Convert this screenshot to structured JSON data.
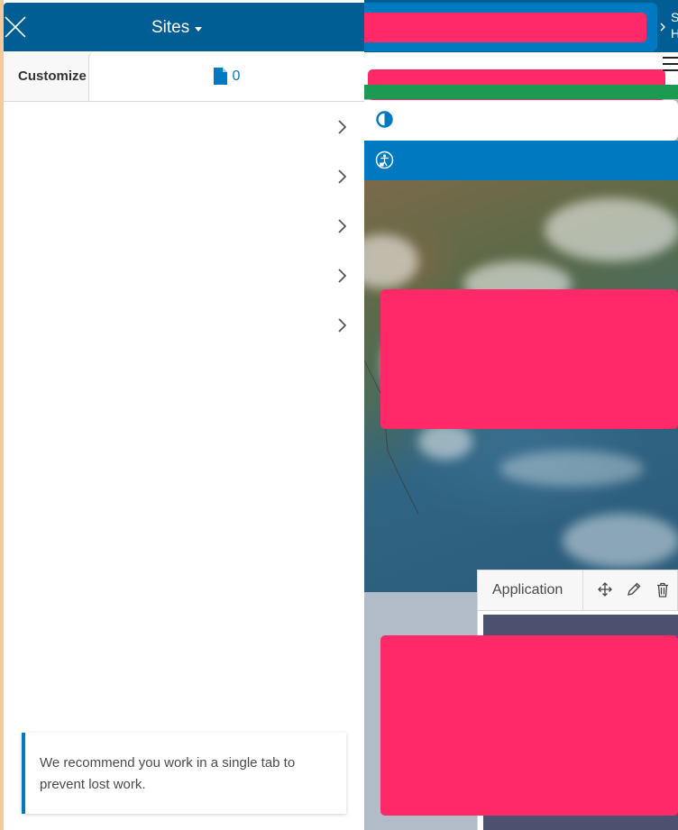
{
  "header": {
    "title": "Sites",
    "close_icon": "close-icon",
    "caret_icon": "caret-down-icon"
  },
  "tabs": {
    "customize_label": "Customize",
    "pages_count": "0",
    "pages_icon": "document-icon"
  },
  "menu": {
    "items": [
      {
        "chevron": "chevron-right-icon"
      },
      {
        "chevron": "chevron-right-icon"
      },
      {
        "chevron": "chevron-right-icon"
      },
      {
        "chevron": "chevron-right-icon"
      },
      {
        "chevron": "chevron-right-icon"
      }
    ]
  },
  "toast": {
    "message": "We recommend you work in a single tab to prevent lost work."
  },
  "preview": {
    "breadcrumb": [
      "S",
      "H"
    ],
    "hamburger_icon": "hamburger-menu-icon",
    "contrast_icon": "contrast-icon",
    "accessibility_icon": "accessibility-lock-icon",
    "app_toolbar": {
      "label": "Application",
      "move_icon": "move-icon",
      "edit_icon": "pencil-icon",
      "delete_icon": "trash-icon"
    }
  },
  "colors": {
    "header_blue": "#005e95",
    "accent_blue": "#0079c1",
    "redaction": "#ff2968",
    "green_band": "#1d9a52",
    "app_bg": "#4c5170",
    "page_bg": "#f5c999"
  }
}
